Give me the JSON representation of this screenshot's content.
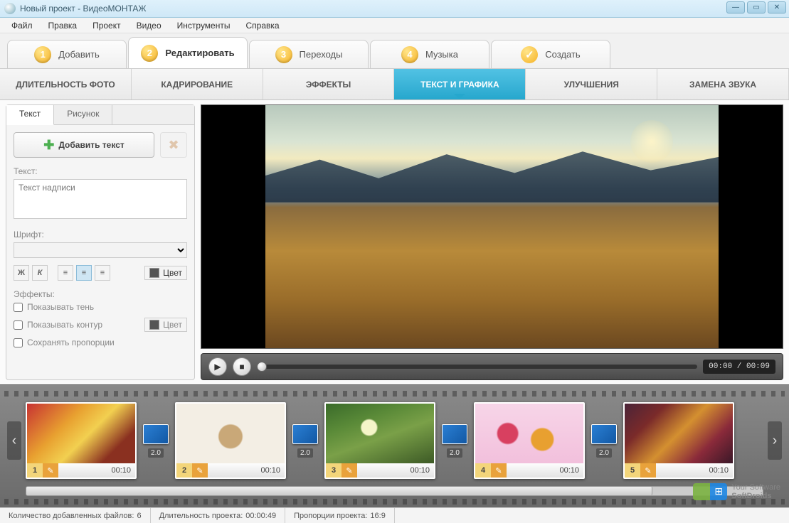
{
  "window": {
    "title": "Новый проект - ВидеоМОНТАЖ"
  },
  "menu": [
    "Файл",
    "Правка",
    "Проект",
    "Видео",
    "Инструменты",
    "Справка"
  ],
  "stages": [
    {
      "num": "1",
      "label": "Добавить"
    },
    {
      "num": "2",
      "label": "Редактировать"
    },
    {
      "num": "3",
      "label": "Переходы"
    },
    {
      "num": "4",
      "label": "Музыка"
    },
    {
      "check": "✓",
      "label": "Создать"
    }
  ],
  "active_stage": 1,
  "subtools": [
    "ДЛИТЕЛЬНОСТЬ ФОТО",
    "КАДРИРОВАНИЕ",
    "ЭФФЕКТЫ",
    "ТЕКСТ И ГРАФИКА",
    "УЛУЧШЕНИЯ",
    "ЗАМЕНА ЗВУКА"
  ],
  "active_subtool": 3,
  "left": {
    "tabs": [
      "Текст",
      "Рисунок"
    ],
    "active_tab": 0,
    "add_text_btn": "Добавить текст",
    "text_label": "Текст:",
    "text_value": "Текст надписи",
    "font_label": "Шрифт:",
    "bold": "Ж",
    "italic": "К",
    "color_label": "Цвет",
    "effects_label": "Эффекты:",
    "shadow_label": "Показывать тень",
    "outline_label": "Показывать контур",
    "keep_ratio_label": "Сохранять пропорции"
  },
  "player": {
    "time": "00:00 / 00:09"
  },
  "timeline": {
    "clips": [
      {
        "num": "1",
        "time": "00:10"
      },
      {
        "num": "2",
        "time": "00:10"
      },
      {
        "num": "3",
        "time": "00:10"
      },
      {
        "num": "4",
        "time": "00:10"
      },
      {
        "num": "5",
        "time": "00:10"
      }
    ],
    "transition_duration": "2.0"
  },
  "status": {
    "files_label": "Количество добавленных файлов:",
    "files_value": "6",
    "duration_label": "Длительность проекта:",
    "duration_value": "00:00:49",
    "aspect_label": "Пропорции проекта:",
    "aspect_value": "16:9"
  },
  "watermark": {
    "line1": "Your Software",
    "line2": "SoftDroids"
  }
}
